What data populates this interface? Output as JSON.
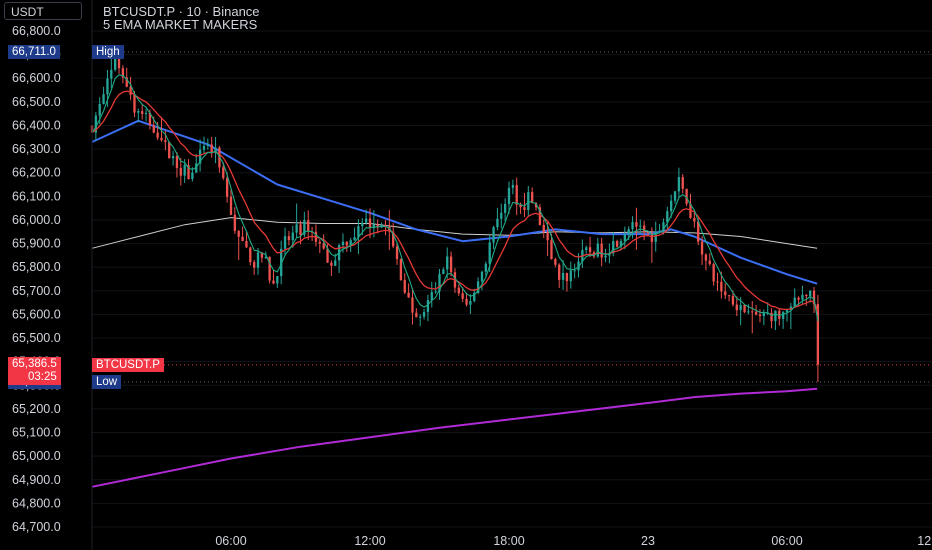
{
  "header": {
    "currency": "USDT",
    "title": "BTCUSDT.P · 10 · Binance",
    "indicator": "5 EMA MARKET MAKERS"
  },
  "markers": {
    "high_value": "66,711.0",
    "high_label": "High",
    "low_value": "65,313.7",
    "low_label": "Low",
    "last_value": "65,386.5",
    "last_countdown": "03:25",
    "last_symbol": "BTCUSDT.P"
  },
  "colors": {
    "up": "#26a69a",
    "down": "#ef5350",
    "ema_fast": "#1faa84",
    "ema_red": "#e53935",
    "ema_blue": "#3b6ef5",
    "ema_white": "#cfcfcf",
    "ema_purple": "#b02ad6",
    "badge_blue": "#1e3a8a",
    "badge_red": "#f23645"
  },
  "chart_data": {
    "type": "candlestick",
    "symbol": "BTCUSDT.P",
    "interval": "10",
    "exchange": "Binance",
    "ylim": [
      64700,
      66800
    ],
    "y_ticks": [
      "66,800.0",
      "66,700.0",
      "66,600.0",
      "66,500.0",
      "66,400.0",
      "66,300.0",
      "66,200.0",
      "66,100.0",
      "66,000.0",
      "65,900.0",
      "65,800.0",
      "65,700.0",
      "65,600.0",
      "65,500.0",
      "65,400.0",
      "65,300.0",
      "65,200.0",
      "65,100.0",
      "65,000.0",
      "64,900.0",
      "64,800.0",
      "64,700.0"
    ],
    "y_tick_values": [
      66800,
      66700,
      66600,
      66500,
      66400,
      66300,
      66200,
      66100,
      66000,
      65900,
      65800,
      65700,
      65600,
      65500,
      65400,
      65300,
      65200,
      65100,
      65000,
      64900,
      64800,
      64700
    ],
    "x_ticks": [
      {
        "label": "06:00",
        "t": 6
      },
      {
        "label": "12:00",
        "t": 12
      },
      {
        "label": "18:00",
        "t": 18
      },
      {
        "label": "23",
        "t": 24
      },
      {
        "label": "06:00",
        "t": 30
      },
      {
        "label": "12:",
        "t": 36
      }
    ],
    "high": 66711.0,
    "low": 65313.7,
    "last": 65386.5,
    "price_path": [
      [
        0.0,
        66400
      ],
      [
        0.5,
        66520
      ],
      [
        1.0,
        66680
      ],
      [
        1.4,
        66620
      ],
      [
        1.8,
        66470
      ],
      [
        2.3,
        66430
      ],
      [
        2.8,
        66380
      ],
      [
        3.3,
        66280
      ],
      [
        3.8,
        66220
      ],
      [
        4.3,
        66180
      ],
      [
        4.8,
        66300
      ],
      [
        5.3,
        66290
      ],
      [
        5.8,
        66100
      ],
      [
        6.2,
        65960
      ],
      [
        6.6,
        65880
      ],
      [
        7.0,
        65820
      ],
      [
        7.4,
        65850
      ],
      [
        7.8,
        65720
      ],
      [
        8.3,
        65900
      ],
      [
        8.8,
        65950
      ],
      [
        9.3,
        65980
      ],
      [
        9.8,
        65900
      ],
      [
        10.3,
        65820
      ],
      [
        10.8,
        65900
      ],
      [
        11.3,
        65940
      ],
      [
        11.8,
        65980
      ],
      [
        12.3,
        66000
      ],
      [
        12.8,
        65950
      ],
      [
        13.3,
        65780
      ],
      [
        13.7,
        65640
      ],
      [
        14.1,
        65560
      ],
      [
        14.5,
        65650
      ],
      [
        14.9,
        65720
      ],
      [
        15.3,
        65850
      ],
      [
        15.7,
        65700
      ],
      [
        16.1,
        65620
      ],
      [
        16.5,
        65700
      ],
      [
        16.9,
        65800
      ],
      [
        17.3,
        65950
      ],
      [
        17.7,
        66050
      ],
      [
        18.1,
        66150
      ],
      [
        18.5,
        66050
      ],
      [
        18.9,
        66100
      ],
      [
        19.3,
        66000
      ],
      [
        19.7,
        65880
      ],
      [
        20.1,
        65760
      ],
      [
        20.5,
        65760
      ],
      [
        20.9,
        65820
      ],
      [
        21.3,
        65860
      ],
      [
        21.7,
        65870
      ],
      [
        22.1,
        65870
      ],
      [
        22.5,
        65900
      ],
      [
        22.9,
        65940
      ],
      [
        23.3,
        66000
      ],
      [
        23.7,
        65960
      ],
      [
        24.1,
        65930
      ],
      [
        24.5,
        65960
      ],
      [
        24.9,
        66060
      ],
      [
        25.3,
        66160
      ],
      [
        25.7,
        66080
      ],
      [
        26.1,
        65950
      ],
      [
        26.5,
        65820
      ],
      [
        26.9,
        65740
      ],
      [
        27.3,
        65690
      ],
      [
        27.7,
        65660
      ],
      [
        28.1,
        65620
      ],
      [
        28.5,
        65600
      ],
      [
        28.9,
        65590
      ],
      [
        29.3,
        65600
      ],
      [
        29.7,
        65590
      ],
      [
        30.1,
        65620
      ],
      [
        30.5,
        65660
      ],
      [
        30.9,
        65700
      ],
      [
        31.2,
        65640
      ],
      [
        31.35,
        65390
      ]
    ],
    "ema_blue": [
      [
        0,
        66330
      ],
      [
        2,
        66420
      ],
      [
        5,
        66320
      ],
      [
        8,
        66150
      ],
      [
        10,
        66090
      ],
      [
        12,
        66030
      ],
      [
        14,
        65960
      ],
      [
        16,
        65910
      ],
      [
        18,
        65930
      ],
      [
        20,
        65960
      ],
      [
        22,
        65940
      ],
      [
        24,
        65940
      ],
      [
        25,
        65960
      ],
      [
        26,
        65930
      ],
      [
        28,
        65840
      ],
      [
        30,
        65770
      ],
      [
        31.3,
        65730
      ]
    ],
    "ema_white": [
      [
        0,
        65880
      ],
      [
        2,
        65930
      ],
      [
        4,
        65980
      ],
      [
        6,
        66010
      ],
      [
        8,
        65990
      ],
      [
        10,
        65985
      ],
      [
        12,
        65985
      ],
      [
        14,
        65960
      ],
      [
        16,
        65940
      ],
      [
        18,
        65935
      ],
      [
        20,
        65950
      ],
      [
        22,
        65945
      ],
      [
        24,
        65950
      ],
      [
        26,
        65945
      ],
      [
        28,
        65930
      ],
      [
        30,
        65900
      ],
      [
        31.3,
        65880
      ]
    ],
    "ema_purple": [
      [
        0,
        64870
      ],
      [
        3,
        64930
      ],
      [
        6,
        64990
      ],
      [
        9,
        65040
      ],
      [
        12,
        65080
      ],
      [
        15,
        65120
      ],
      [
        18,
        65155
      ],
      [
        21,
        65190
      ],
      [
        24,
        65225
      ],
      [
        26,
        65250
      ],
      [
        28,
        65265
      ],
      [
        30,
        65275
      ],
      [
        31.3,
        65285
      ]
    ]
  }
}
